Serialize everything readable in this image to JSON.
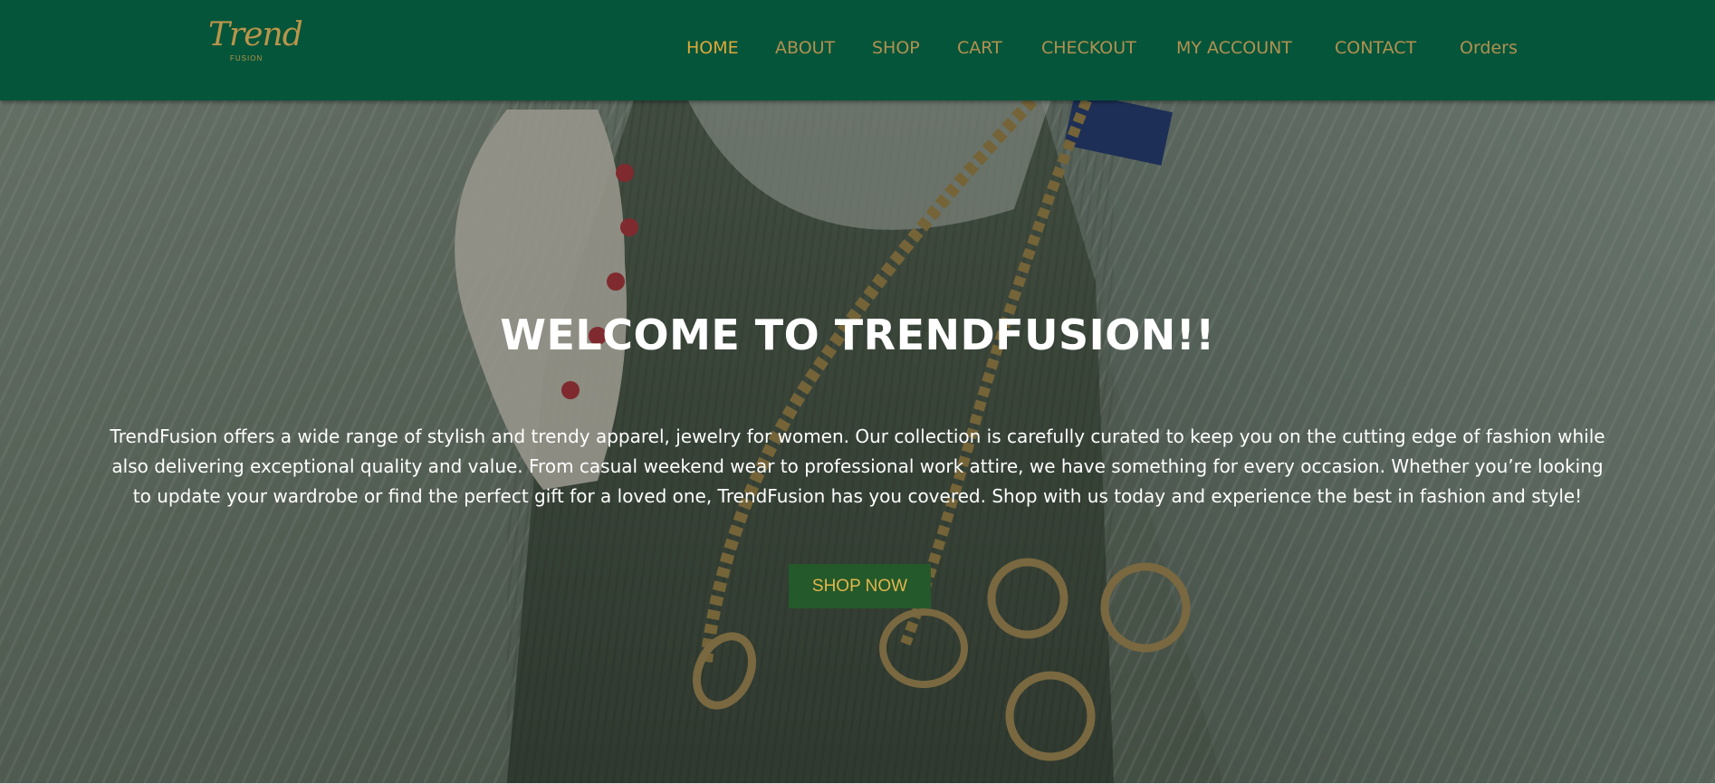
{
  "brand": {
    "logo_script": "Trend",
    "logo_sub": "FUSION"
  },
  "nav": {
    "items": [
      {
        "label": "HOME",
        "active": true
      },
      {
        "label": "ABOUT"
      },
      {
        "label": "SHOP"
      },
      {
        "label": "CART"
      },
      {
        "label": "CHECKOUT"
      },
      {
        "label": "MY ACCOUNT"
      },
      {
        "label": "CONTACT"
      },
      {
        "label": "Orders"
      }
    ]
  },
  "hero": {
    "title": "WELCOME TO TRENDFUSION!!",
    "text": "TrendFusion offers a wide range of stylish and trendy apparel, jewelry for women. Our collection is carefully curated to keep you on the cutting edge of fashion while also delivering exceptional quality and value. From casual weekend wear to professional work attire, we have something for every occasion. Whether you’re looking to update your wardrobe or find the perfect gift for a loved one, TrendFusion has you covered. Shop with us today and experience the best in fashion and style!",
    "button_label": "SHOP NOW"
  },
  "colors": {
    "header_bg": "#05553b",
    "nav_text": "#b2914f",
    "nav_active": "#e0a838",
    "button_bg": "#24592b",
    "button_text": "#e2b64b"
  }
}
